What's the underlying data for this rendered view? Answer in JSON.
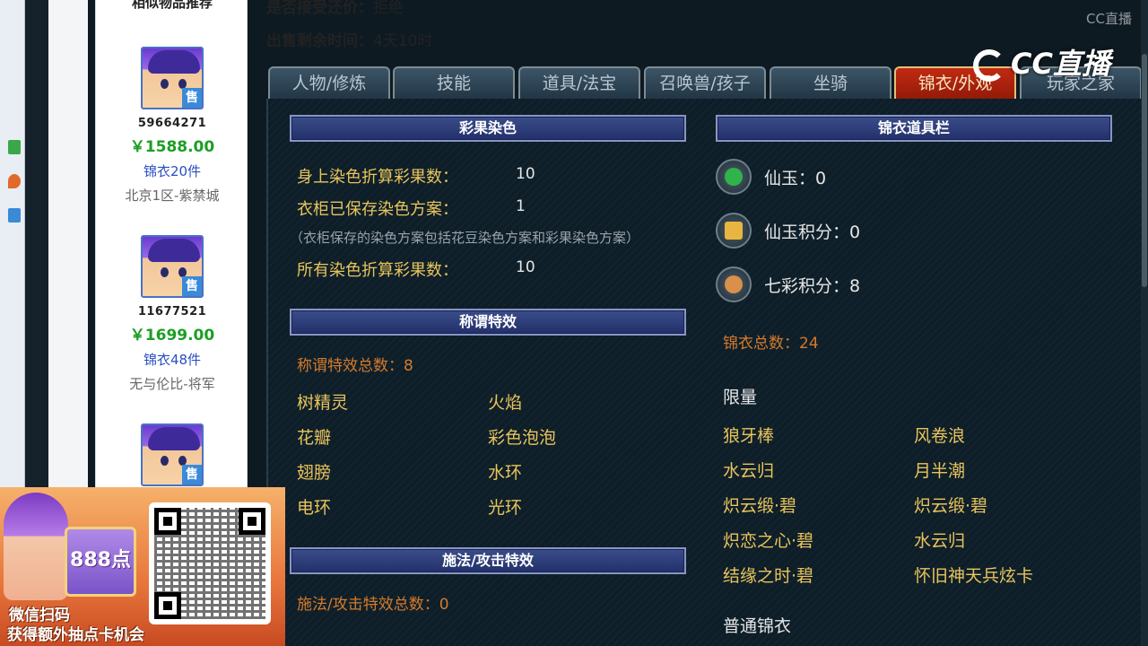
{
  "header": {
    "bargain_label": "是否接受还价：",
    "bargain_value": "拒绝",
    "remaining_label": "出售剩余时间：",
    "remaining_value": "4天10时"
  },
  "similar": {
    "title": "相似物品推荐",
    "items": [
      {
        "id": "59664271",
        "price": "￥1588.00",
        "count": "锦衣20件",
        "server": "北京1区-紫禁城",
        "badge": "售"
      },
      {
        "id": "11677521",
        "price": "￥1699.00",
        "count": "锦衣48件",
        "server": "无与伦比-将军",
        "badge": "售"
      },
      {
        "badge": "售"
      }
    ]
  },
  "tabs": [
    {
      "label": "人物/修炼",
      "active": false
    },
    {
      "label": "技能",
      "active": false
    },
    {
      "label": "道具/法宝",
      "active": false
    },
    {
      "label": "召唤兽/孩子",
      "active": false
    },
    {
      "label": "坐骑",
      "active": false
    },
    {
      "label": "锦衣/外观",
      "active": true
    },
    {
      "label": "玩家之家",
      "active": false
    }
  ],
  "dye": {
    "title": "彩果染色",
    "rows": [
      {
        "label": "身上染色折算彩果数：",
        "value": "10"
      },
      {
        "label": "衣柜已保存染色方案：",
        "value": "1"
      },
      {
        "label": "所有染色折算彩果数：",
        "value": "10"
      }
    ],
    "note": "（衣柜保存的染色方案包括花豆染色方案和彩果染色方案）"
  },
  "title_effects": {
    "title": "称谓特效",
    "total": "称谓特效总数：8",
    "items": [
      "树精灵",
      "火焰",
      "花瓣",
      "彩色泡泡",
      "翅膀",
      "水环",
      "电环",
      "光环"
    ]
  },
  "cast_effects": {
    "title": "施法/攻击特效",
    "total": "施法/攻击特效总数：0"
  },
  "wardrobe": {
    "title": "锦衣道具栏",
    "currencies": [
      {
        "label": "仙玉：0",
        "icon": "jade-icon",
        "color": "#2fb34a"
      },
      {
        "label": "仙玉积分：0",
        "icon": "jade-points-icon",
        "color": "#e8b640"
      },
      {
        "label": "七彩积分：8",
        "icon": "rainbow-points-icon",
        "color": "#d8904a"
      }
    ],
    "total": "锦衣总数：24",
    "limited_label": "限量",
    "limited_items": [
      "狼牙棒",
      "风卷浪",
      "水云归",
      "月半潮",
      "炽云缎·碧",
      "炽云缎·碧",
      "炽恋之心·碧",
      "水云归",
      "结缘之时·碧",
      "怀旧神天兵炫卡"
    ],
    "normal_label": "普通锦衣"
  },
  "watermark": {
    "main": "CC直播",
    "small": "CC直播"
  },
  "promo": {
    "card_value": "888点",
    "line1": "微信扫码",
    "line2": "获得额外抽点卡机会"
  },
  "colors": {
    "accent_active_tab": "#c22a12",
    "gold_text": "#e9c45c",
    "price_green": "#1c9e23"
  }
}
